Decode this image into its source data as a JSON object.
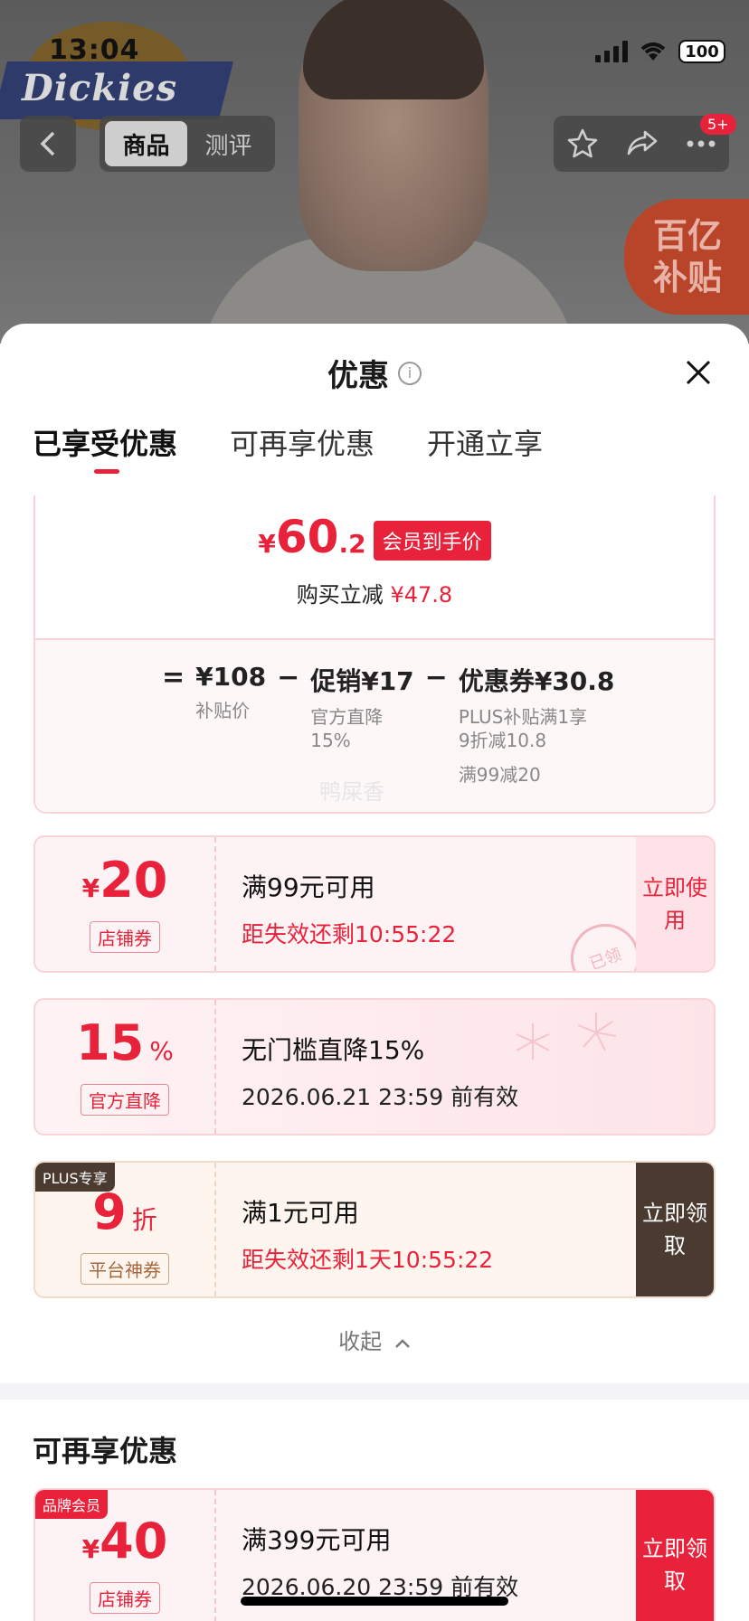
{
  "status_bar": {
    "time": "13:04",
    "battery": "100"
  },
  "header": {
    "brand_logo_text": "Dickies",
    "tabs": [
      {
        "label": "商品"
      },
      {
        "label": "测评"
      }
    ],
    "badge": "5+",
    "promo_line1": "百亿",
    "promo_line2": "补贴"
  },
  "sheet": {
    "title": "优惠",
    "tabs": [
      {
        "label": "已享受优惠"
      },
      {
        "label": "可再享优惠"
      },
      {
        "label": "开通立享"
      }
    ],
    "price": {
      "currency": "¥",
      "integer": "60",
      "decimal": ".2",
      "tag": "会员到手价",
      "reduce_label": "购买立减",
      "reduce_value": "¥47.8"
    },
    "formula": {
      "eq": "=",
      "base_value": "¥108",
      "base_label": "补贴价",
      "minus": "−",
      "promo_value": "促销¥17",
      "promo_label_1": "官方直降",
      "promo_label_2": "15%",
      "coupon_value": "优惠券¥30.8",
      "coupon_label_1": "PLUS补贴满1享",
      "coupon_label_2": "9折减10.8",
      "coupon_label_3": "满99减20"
    },
    "watermark": "鸭屎香",
    "coupons": [
      {
        "amount": "20",
        "currency": "¥",
        "type": "店铺券",
        "title": "满99元可用",
        "time": "距失效还剩10:55:22",
        "action": "立即使用",
        "stamp": "已领"
      },
      {
        "amount": "15",
        "suffix": "%",
        "type": "官方直降",
        "title": "无门槛直降15%",
        "time": "2026.06.21 23:59 前有效"
      },
      {
        "corner": "PLUS专享",
        "amount": "9",
        "suffix": "折",
        "type": "平台神券",
        "title": "满1元可用",
        "time": "距失效还剩1天10:55:22",
        "action": "立即领取"
      },
      {
        "corner": "品牌会员",
        "amount": "40",
        "currency": "¥",
        "type": "店铺券",
        "title": "满399元可用",
        "time": "2026.06.20 23:59 前有效",
        "action": "立即领取"
      }
    ],
    "collapse_label": "收起",
    "section2_title": "可再享优惠"
  },
  "colors": {
    "accent": "#e8223a",
    "plus_dark": "#4a3a30"
  }
}
